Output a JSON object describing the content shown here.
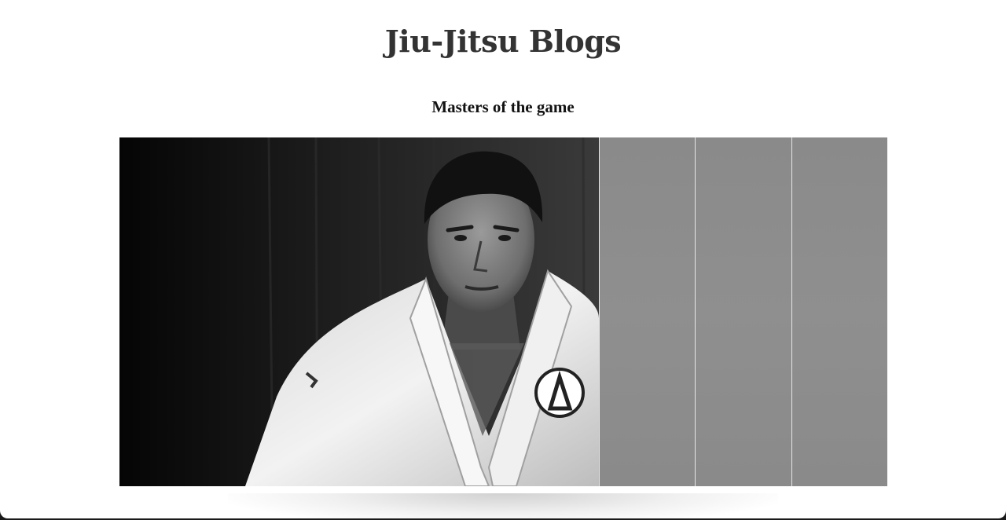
{
  "header": {
    "title": "Jiu-Jitsu Blogs"
  },
  "section": {
    "title": "Masters of the game"
  },
  "gallery": {
    "panels": [
      {
        "name": "photo-master",
        "active": true
      },
      {
        "name": "photo-2",
        "active": false
      },
      {
        "name": "photo-3",
        "active": false
      },
      {
        "name": "photo-4",
        "active": false
      }
    ]
  },
  "colors": {
    "title": "#333333",
    "collapsed_panel": "#8b8b8b",
    "background": "#ffffff"
  }
}
